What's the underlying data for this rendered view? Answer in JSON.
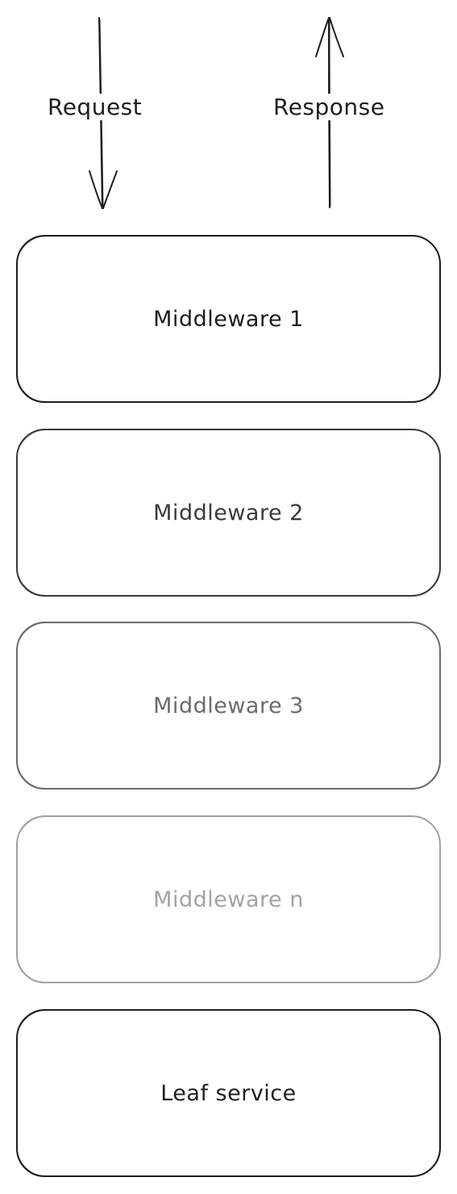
{
  "arrows": {
    "request_label": "Request",
    "response_label": "Response"
  },
  "boxes": [
    {
      "label": "Middleware 1",
      "color": "#1e1e1e"
    },
    {
      "label": "Middleware 2",
      "color": "#3a3a3a"
    },
    {
      "label": "Middleware 3",
      "color": "#6b6b6b"
    },
    {
      "label": "Middleware n",
      "color": "#a3a3a3"
    },
    {
      "label": "Leaf service",
      "color": "#1e1e1e"
    }
  ]
}
